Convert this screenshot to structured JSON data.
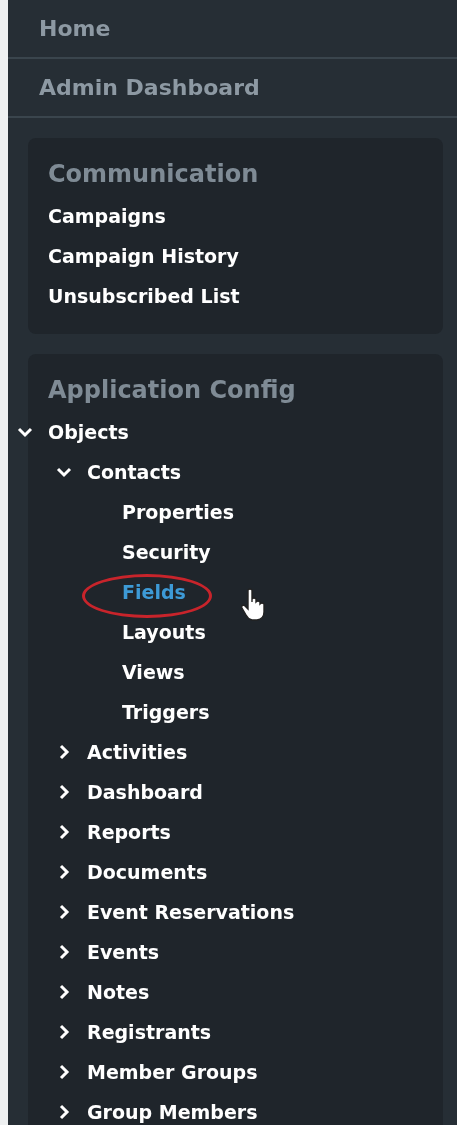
{
  "nav": [
    {
      "label": "Home"
    },
    {
      "label": "Admin Dashboard"
    }
  ],
  "panels": [
    {
      "heading": "Communication",
      "links": [
        {
          "label": "Campaigns"
        },
        {
          "label": "Campaign History"
        },
        {
          "label": "Unsubscribed List"
        }
      ]
    },
    {
      "heading": "Application Config",
      "tree": [
        {
          "label": "Objects",
          "expanded": true,
          "selected": false,
          "children": [
            {
              "label": "Contacts",
              "expanded": true,
              "selected": false,
              "children": [
                {
                  "label": "Properties",
                  "selected": false
                },
                {
                  "label": "Security",
                  "selected": false
                },
                {
                  "label": "Fields",
                  "selected": true,
                  "circled": true,
                  "hovered": true
                },
                {
                  "label": "Layouts",
                  "selected": false
                },
                {
                  "label": "Views",
                  "selected": false
                },
                {
                  "label": "Triggers",
                  "selected": false
                }
              ]
            },
            {
              "label": "Activities",
              "expanded": false,
              "selected": false
            },
            {
              "label": "Dashboard",
              "expanded": false,
              "selected": false
            },
            {
              "label": "Reports",
              "expanded": false,
              "selected": false
            },
            {
              "label": "Documents",
              "expanded": false,
              "selected": false
            },
            {
              "label": "Event Reservations",
              "expanded": false,
              "selected": false
            },
            {
              "label": "Events",
              "expanded": false,
              "selected": false
            },
            {
              "label": "Notes",
              "expanded": false,
              "selected": false
            },
            {
              "label": "Registrants",
              "expanded": false,
              "selected": false
            },
            {
              "label": "Member Groups",
              "expanded": false,
              "selected": false
            },
            {
              "label": "Group Members",
              "expanded": false,
              "selected": false
            }
          ]
        }
      ]
    }
  ]
}
